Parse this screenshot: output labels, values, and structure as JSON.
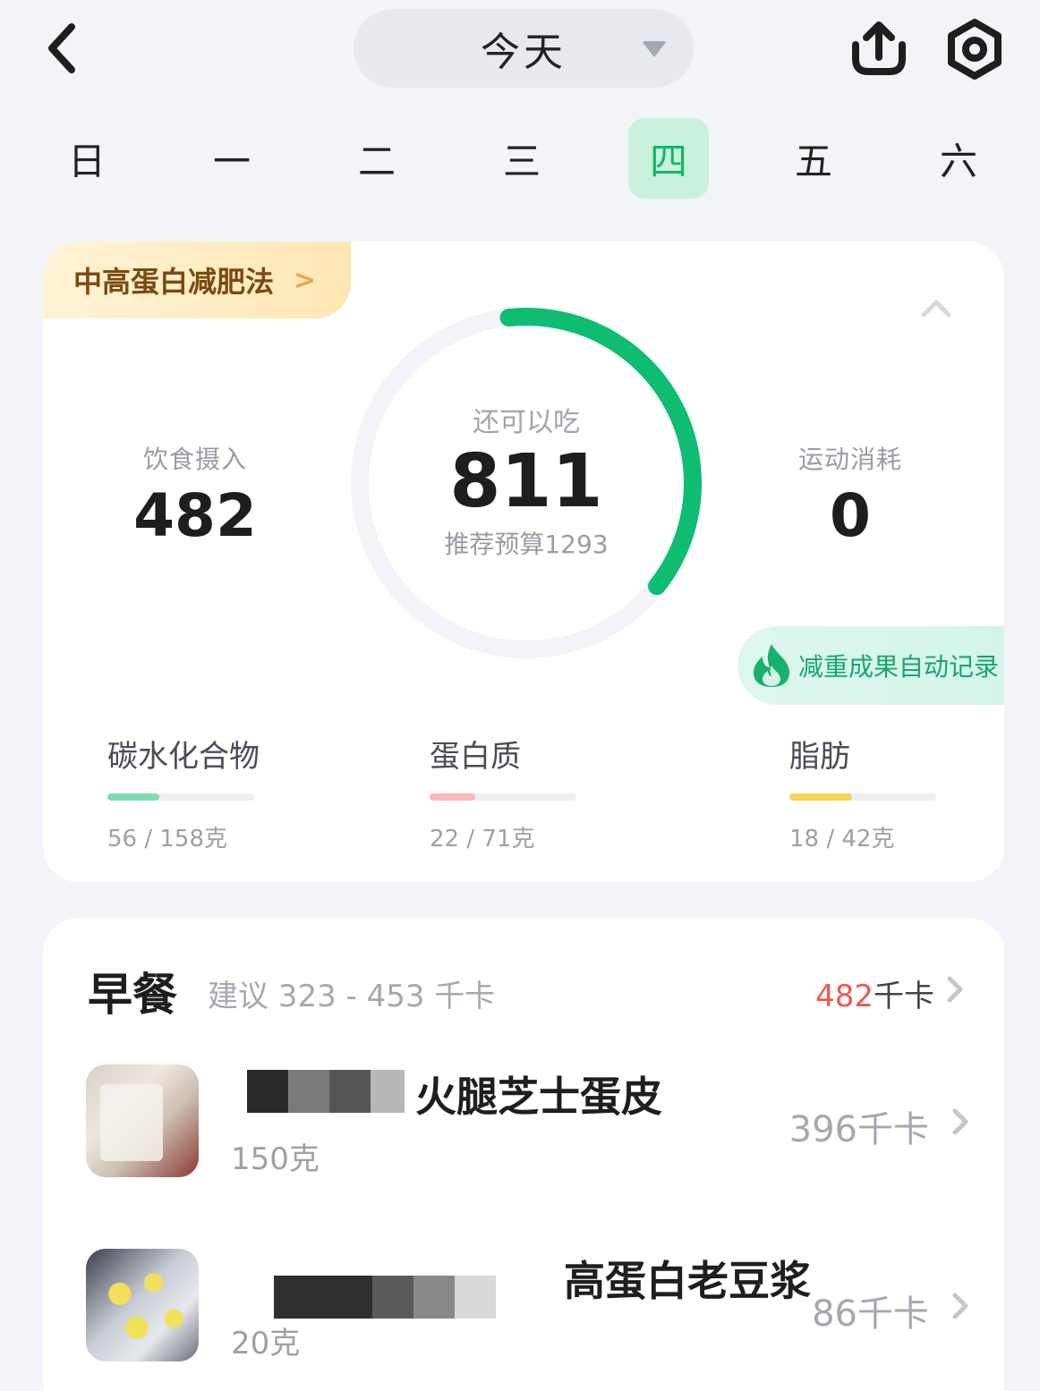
{
  "header": {
    "date_label": "今天",
    "back_icon": "chevron-left-icon",
    "share_icon": "share-upload-icon",
    "settings_icon": "hex-settings-icon"
  },
  "week": {
    "days": [
      "日",
      "一",
      "二",
      "三",
      "四",
      "五",
      "六"
    ],
    "selected": "四",
    "selected_color": "#12b76a"
  },
  "summary": {
    "plan_label": "中高蛋白减肥法",
    "intake_label": "饮食摄入",
    "intake_value": "482",
    "remaining_label": "还可以吃",
    "remaining_value": "811",
    "budget_text": "推荐预算1293",
    "exercise_label": "运动消耗",
    "exercise_value": "0",
    "record_label": "减重成果自动记录",
    "ring_progress": 0.3728,
    "ring_color": "#0fbd72"
  },
  "macros": [
    {
      "name": "碳水化合物",
      "amount": "56 / 158克",
      "progress": 0.354,
      "color": "#7edcb3"
    },
    {
      "name": "蛋白质",
      "amount": "22 / 71克",
      "progress": 0.31,
      "color": "#f8b9b8"
    },
    {
      "name": "脂肪",
      "amount": "18 / 42克",
      "progress": 0.429,
      "color": "#f6d455"
    }
  ],
  "meal": {
    "title": "早餐",
    "suggestion": "建议 323 - 453 千卡",
    "total_value": "482",
    "total_unit": "千卡",
    "items": [
      {
        "name": "火腿芝士蛋皮",
        "weight": "150克",
        "kcal": "396千卡"
      },
      {
        "name": "高蛋白老豆浆",
        "weight": "20克",
        "kcal": "86千卡"
      }
    ]
  }
}
